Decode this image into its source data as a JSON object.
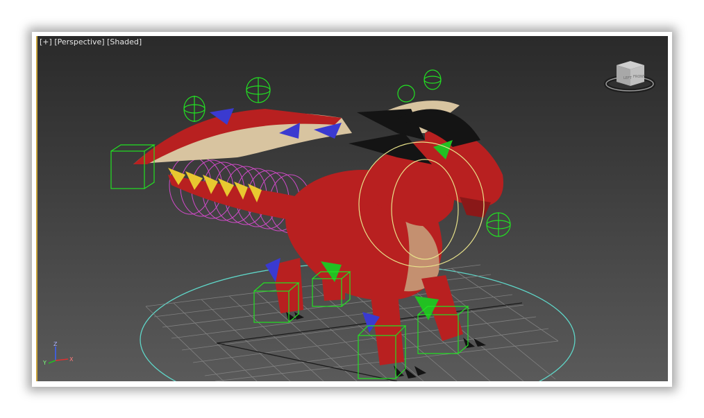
{
  "viewport": {
    "label_plus": "[+]",
    "label_view": "[Perspective]",
    "label_shading": "[Shaded]"
  },
  "viewcube": {
    "top_face": "TOP",
    "left_face": "LEFT",
    "front_face": "FRONT"
  },
  "axis": {
    "x_label": "X",
    "y_label": "Y",
    "z_label": "Z"
  },
  "colors": {
    "gizmo_green": "#22e222",
    "dragon_red": "#b82020",
    "grid_line": "#8a8a8a",
    "ground_circle": "#5fd6c8",
    "selection_yellow": "#e8e28a",
    "spline_pink": "#d04bc8",
    "spike_yellow": "#e8c830",
    "bone_blue": "#3a3ad0",
    "horn_black": "#141414"
  }
}
